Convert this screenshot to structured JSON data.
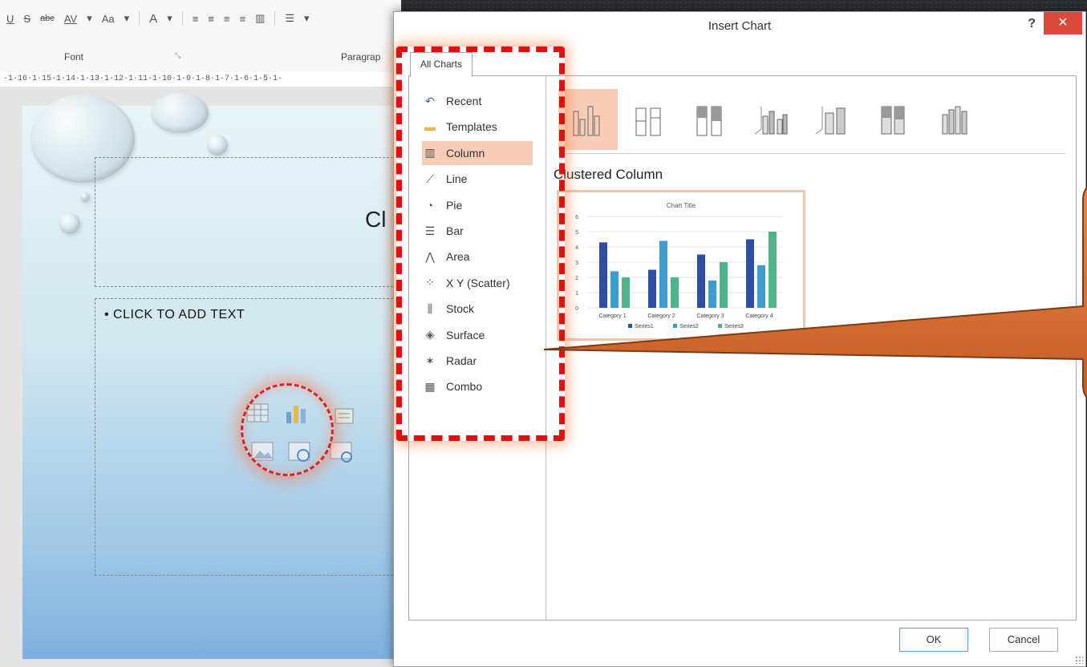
{
  "ribbon": {
    "underline": "U",
    "shadow": "S",
    "strike": "abc",
    "spacing": "AV",
    "case": "Aa",
    "font_color": "A",
    "font_group": "Font",
    "paragraph_group": "Paragrap"
  },
  "ruler_text": "·1·16·1·15·1·14·1·13·1·12·1·11·1·10·1·9·1·8·1·7·1·6·1·5·1·",
  "slide": {
    "title_fragment": "Cl",
    "bullet": "• CLICK TO ADD TEXT"
  },
  "dialog": {
    "title": "Insert Chart",
    "help": "?",
    "close": "✕",
    "tab": "All Charts",
    "chart_types": [
      {
        "label": "Recent",
        "icon": "recent-icon"
      },
      {
        "label": "Templates",
        "icon": "templates-icon"
      },
      {
        "label": "Column",
        "icon": "column-chart-icon",
        "selected": true
      },
      {
        "label": "Line",
        "icon": "line-chart-icon"
      },
      {
        "label": "Pie",
        "icon": "pie-chart-icon"
      },
      {
        "label": "Bar",
        "icon": "bar-chart-icon"
      },
      {
        "label": "Area",
        "icon": "area-chart-icon"
      },
      {
        "label": "X Y (Scatter)",
        "icon": "scatter-chart-icon"
      },
      {
        "label": "Stock",
        "icon": "stock-chart-icon"
      },
      {
        "label": "Surface",
        "icon": "surface-chart-icon"
      },
      {
        "label": "Radar",
        "icon": "radar-chart-icon"
      },
      {
        "label": "Combo",
        "icon": "combo-chart-icon"
      }
    ],
    "selected_subtype": "Clustered Column",
    "ok": "OK",
    "cancel": "Cancel"
  },
  "colors": {
    "selection": "#f7cdb7",
    "highlight": "#e01010",
    "callout": "#d86a2f",
    "series1": "#2e4fa3",
    "series2": "#3d9dd1",
    "series3": "#4db38b"
  },
  "chart_data": {
    "type": "bar",
    "title": "Chart Title",
    "categories": [
      "Category 1",
      "Category 2",
      "Category 3",
      "Category 4"
    ],
    "series": [
      {
        "name": "Series1",
        "values": [
          4.3,
          2.5,
          3.5,
          4.5
        ]
      },
      {
        "name": "Series2",
        "values": [
          2.4,
          4.4,
          1.8,
          2.8
        ]
      },
      {
        "name": "Series3",
        "values": [
          2,
          2,
          3,
          5
        ]
      }
    ],
    "ylim": [
      0,
      6
    ],
    "yticks": [
      "0",
      "1",
      "2",
      "3",
      "4",
      "5",
      "6"
    ],
    "grid": true,
    "legend": "bottom"
  }
}
